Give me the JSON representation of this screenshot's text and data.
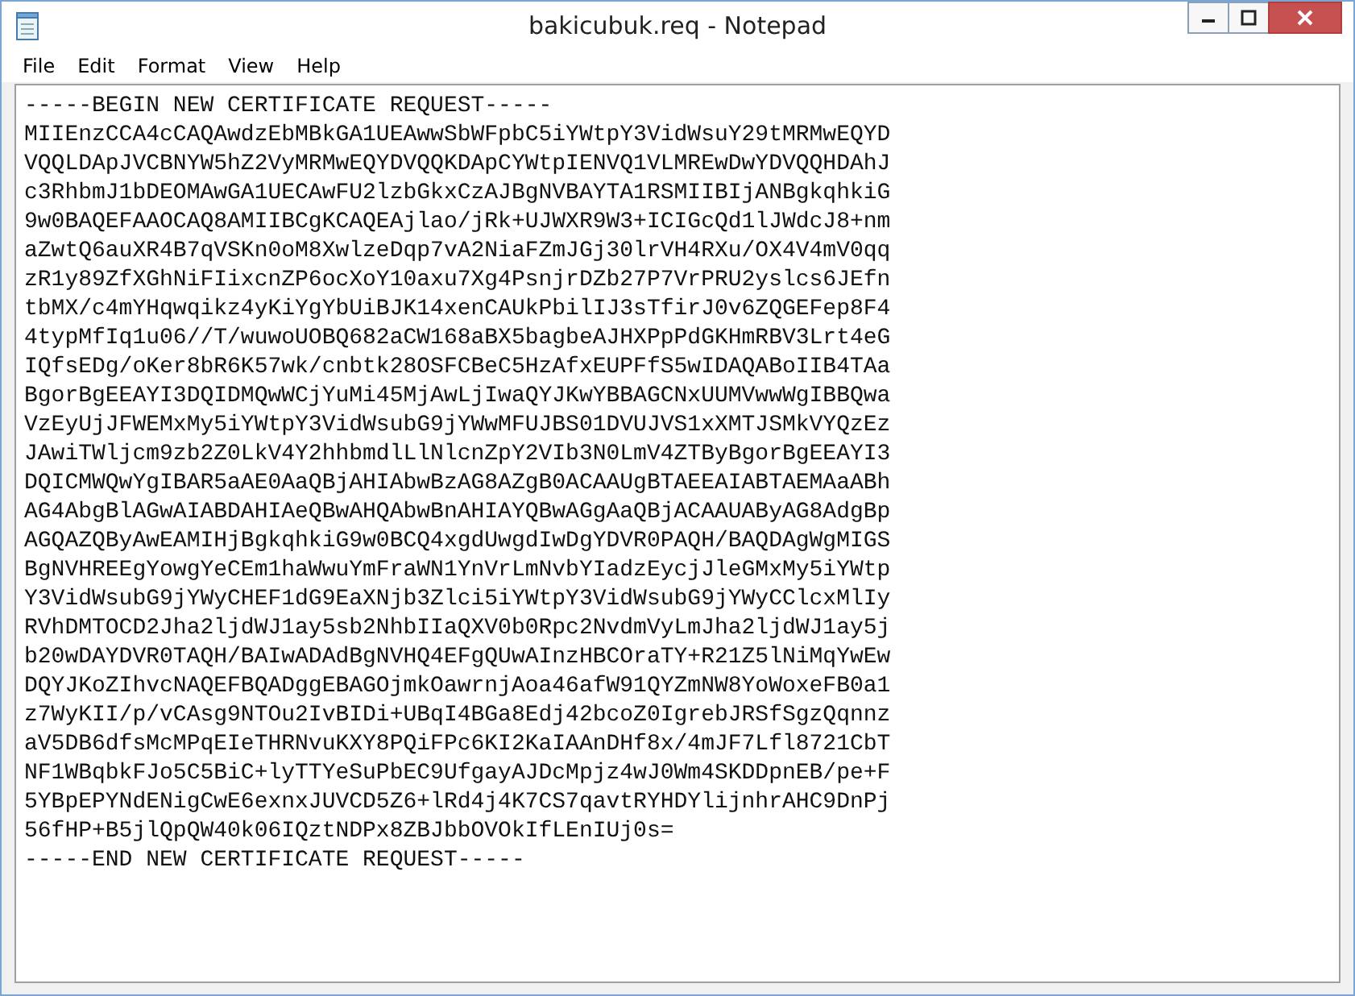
{
  "window": {
    "title": "bakicubuk.req - Notepad"
  },
  "menu": [
    "File",
    "Edit",
    "Format",
    "View",
    "Help"
  ],
  "document": {
    "lines": [
      "-----BEGIN NEW CERTIFICATE REQUEST-----",
      "MIIEnzCCA4cCAQAwdzEbMBkGA1UEAwwSbWFpbC5iYWtpY3VidWsuY29tMRMwEQYD",
      "VQQLDApJVCBNYW5hZ2VyMRMwEQYDVQQKDApCYWtpIENVQ1VLMREwDwYDVQQHDAhJ",
      "c3RhbmJ1bDEOMAwGA1UECAwFU2lzbGkxCzAJBgNVBAYTA1RSMIIBIjANBgkqhkiG",
      "9w0BAQEFAAOCAQ8AMIIBCgKCAQEAjlao/jRk+UJWXR9W3+ICIGcQd1lJWdcJ8+nm",
      "aZwtQ6auXR4B7qVSKn0oM8XwlzeDqp7vA2NiaFZmJGj30lrVH4RXu/OX4V4mV0qq",
      "zR1y89ZfXGhNiFIixcnZP6ocXoY10axu7Xg4PsnjrDZb27P7VrPRU2yslcs6JEfn",
      "tbMX/c4mYHqwqikz4yKiYgYbUiBJK14xenCAUkPbilIJ3sTfirJ0v6ZQGEFep8F4",
      "4typMfIq1u06//T/wuwoUOBQ682aCW168aBX5bagbeAJHXPpPdGKHmRBV3Lrt4eG",
      "IQfsEDg/oKer8bR6K57wk/cnbtk28OSFCBeC5HzAfxEUPFfS5wIDAQABoIIB4TAa",
      "BgorBgEEAYI3DQIDMQwWCjYuMi45MjAwLjIwaQYJKwYBBAGCNxUUMVwwWgIBBQwa",
      "VzEyUjJFWEMxMy5iYWtpY3VidWsubG9jYWwMFUJBS01DVUJVS1xXMTJSMkVYQzEz",
      "JAwiTWljcm9zb2Z0LkV4Y2hhbmdlLlNlcnZpY2VIb3N0LmV4ZTByBgorBgEEAYI3",
      "DQICMWQwYgIBAR5aAE0AaQBjAHIAbwBzAG8AZgB0ACAAUgBTAEEAIABTAEMAaABh",
      "AG4AbgBlAGwAIABDAHIAeQBwAHQAbwBnAHIAYQBwAGgAaQBjACAAUAByAG8AdgBp",
      "AGQAZQByAwEAMIHjBgkqhkiG9w0BCQ4xgdUwgdIwDgYDVR0PAQH/BAQDAgWgMIGS",
      "BgNVHREEgYowgYeCEm1haWwuYmFraWN1YnVrLmNvbYIadzEycjJleGMxMy5iYWtp",
      "Y3VidWsubG9jYWyCHEF1dG9EaXNjb3Zlci5iYWtpY3VidWsubG9jYWyCClcxMlIy",
      "RVhDMTOCD2Jha2ljdWJ1ay5sb2NhbIIaQXV0b0Rpc2NvdmVyLmJha2ljdWJ1ay5j",
      "b20wDAYDVR0TAQH/BAIwADAdBgNVHQ4EFgQUwAInzHBCOraTY+R21Z5lNiMqYwEw",
      "DQYJKoZIhvcNAQEFBQADggEBAGOjmkOawrnjAoa46afW91QYZmNW8YoWoxeFB0a1",
      "z7WyKII/p/vCAsg9NTOu2IvBIDi+UBqI4BGa8Edj42bcoZ0IgrebJRSfSgzQqnnz",
      "aV5DB6dfsMcMPqEIeTHRNvuKXY8PQiFPc6KI2KaIAAnDHf8x/4mJF7Lfl8721CbT",
      "NF1WBqbkFJo5C5BiC+lyTTYeSuPbEC9UfgayAJDcMpjz4wJ0Wm4SKDDpnEB/pe+F",
      "5YBpEPYNdENigCwE6exnxJUVCD5Z6+lRd4j4K7CS7qavtRYHDYlijnhrAHC9DnPj",
      "56fHP+B5jlQpQW40k06IQztNDPx8ZBJbbOVOkIfLEnIUj0s=",
      "-----END NEW CERTIFICATE REQUEST-----"
    ]
  }
}
